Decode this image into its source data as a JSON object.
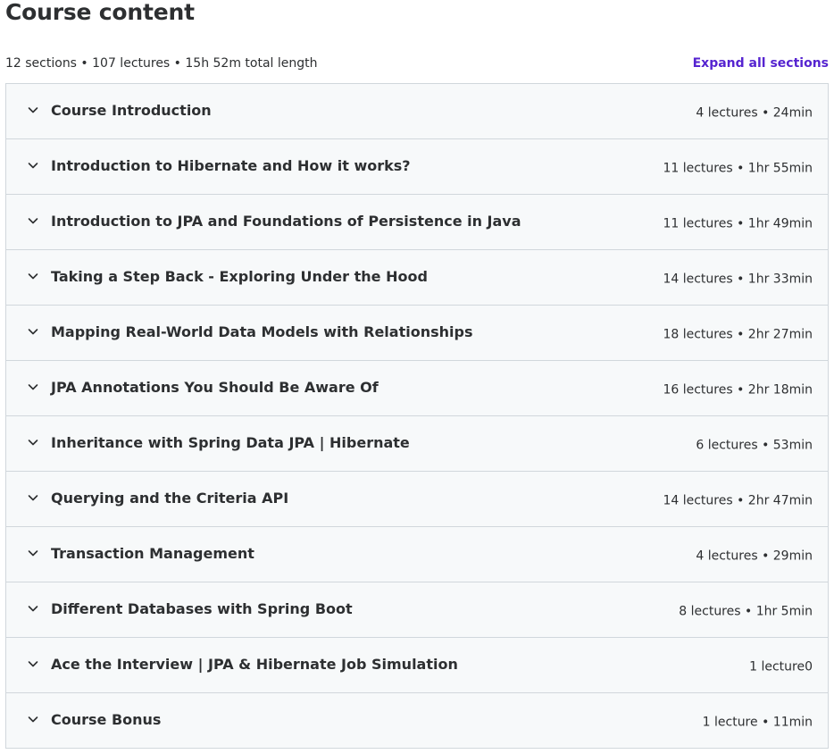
{
  "header": {
    "title": "Course content",
    "summary": "12 sections • 107 lectures • 15h 52m total length",
    "expand_label": "Expand all sections"
  },
  "sections": [
    {
      "title": "Course Introduction",
      "meta": "4 lectures • 24min"
    },
    {
      "title": "Introduction to Hibernate and How it works?",
      "meta": "11 lectures • 1hr 55min"
    },
    {
      "title": "Introduction to JPA and Foundations of Persistence in Java",
      "meta": "11 lectures • 1hr 49min"
    },
    {
      "title": "Taking a Step Back - Exploring Under the Hood",
      "meta": "14 lectures • 1hr 33min"
    },
    {
      "title": "Mapping Real-World Data Models with Relationships",
      "meta": "18 lectures • 2hr 27min"
    },
    {
      "title": "JPA Annotations You Should Be Aware Of",
      "meta": "16 lectures • 2hr 18min"
    },
    {
      "title": "Inheritance with Spring Data JPA | Hibernate",
      "meta": "6 lectures • 53min"
    },
    {
      "title": "Querying and the Criteria API",
      "meta": "14 lectures • 2hr 47min"
    },
    {
      "title": "Transaction Management",
      "meta": "4 lectures • 29min"
    },
    {
      "title": "Different Databases with Spring Boot",
      "meta": "8 lectures • 1hr 5min"
    },
    {
      "title": "Ace the Interview | JPA & Hibernate Job Simulation",
      "meta": "1 lecture0"
    },
    {
      "title": "Course Bonus",
      "meta": "1 lecture • 11min"
    }
  ],
  "icons": {
    "section_toggle": "chevron-down-icon"
  },
  "colors": {
    "text": "#2d2f31",
    "accent": "#5624d0",
    "section_bg": "#f7f9fa",
    "border": "#d1d7dc"
  }
}
